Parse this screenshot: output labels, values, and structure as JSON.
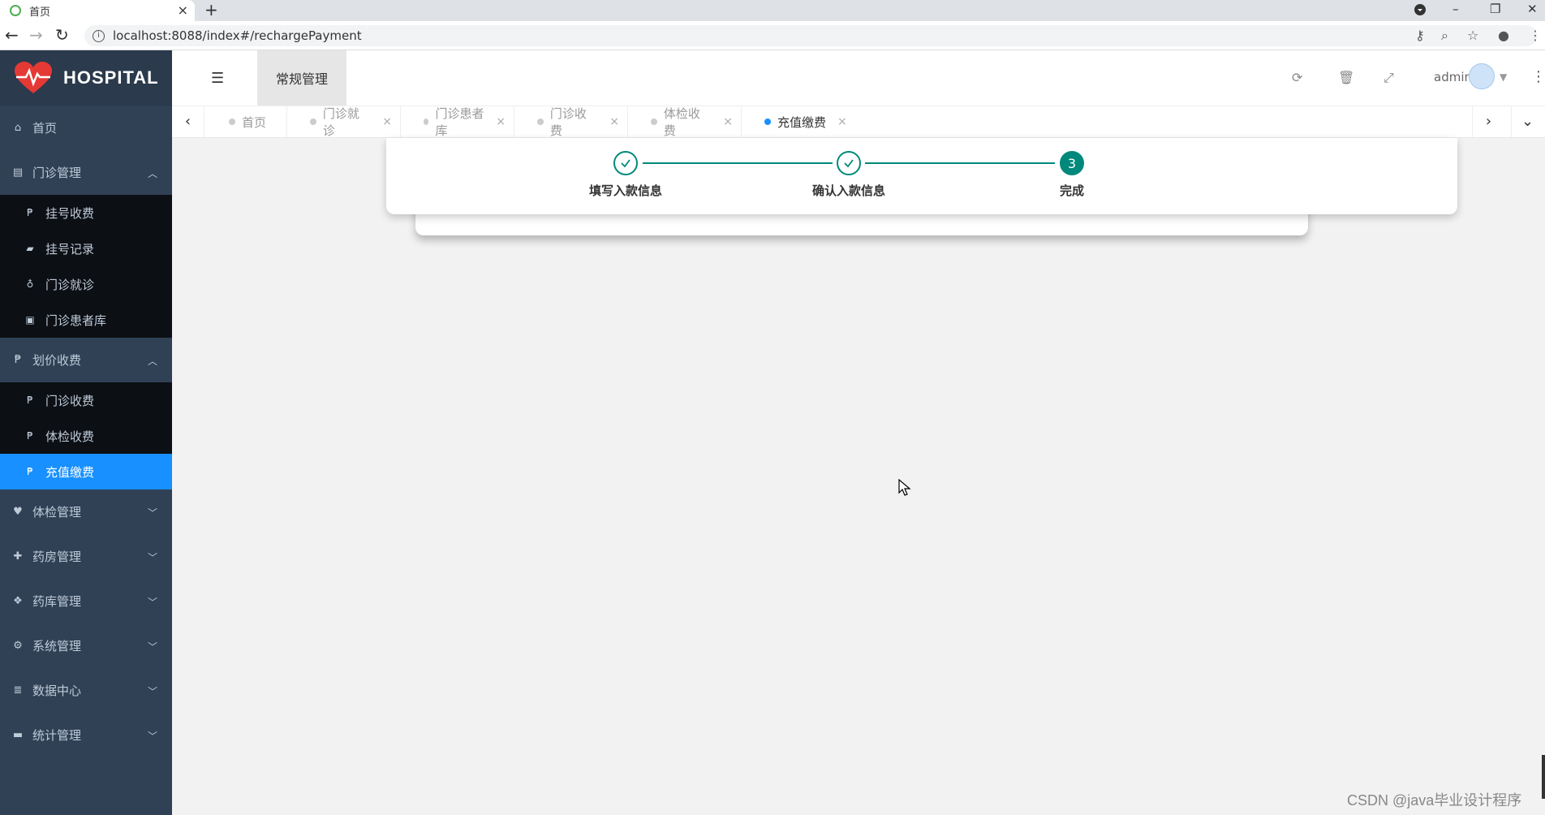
{
  "browser": {
    "tab_title": "首页",
    "tab_close": "×",
    "new_tab": "+",
    "url": "localhost:8088/index#/rechargePayment",
    "win_min": "–",
    "win_max": "❐",
    "win_close": "✕",
    "back": "←",
    "forward": "→",
    "reload": "↻"
  },
  "sidebar": {
    "logo_text": "HOSPITAL",
    "home": "首页",
    "groups": [
      {
        "label": "门诊管理",
        "expanded": true,
        "items": [
          "挂号收费",
          "挂号记录",
          "门诊就诊",
          "门诊患者库"
        ]
      },
      {
        "label": "划价收费",
        "expanded": true,
        "items": [
          "门诊收费",
          "体检收费",
          "充值缴费"
        ]
      },
      {
        "label": "体检管理",
        "expanded": false
      },
      {
        "label": "药房管理",
        "expanded": false
      },
      {
        "label": "药库管理",
        "expanded": false
      },
      {
        "label": "系统管理",
        "expanded": false
      },
      {
        "label": "数据中心",
        "expanded": false
      },
      {
        "label": "统计管理",
        "expanded": false
      }
    ],
    "active_item": "充值缴费"
  },
  "header": {
    "nav_item": "常规管理",
    "user": "admin"
  },
  "tags": [
    {
      "label": "首页",
      "closable": false,
      "active": false
    },
    {
      "label": "门诊就诊",
      "closable": true,
      "active": false
    },
    {
      "label": "门诊患者库",
      "closable": true,
      "active": false
    },
    {
      "label": "门诊收费",
      "closable": true,
      "active": false
    },
    {
      "label": "体检收费",
      "closable": true,
      "active": false
    },
    {
      "label": "充值缴费",
      "closable": true,
      "active": true
    }
  ],
  "steps": [
    {
      "label": "填写入款信息",
      "status": "done"
    },
    {
      "label": "确认入款信息",
      "status": "done"
    },
    {
      "label": "完成",
      "status": "current",
      "number": "3"
    }
  ],
  "watermark": "CSDN @java毕业设计程序",
  "colors": {
    "sidebar": "#304156",
    "active": "#1890ff",
    "step": "#00897b"
  }
}
